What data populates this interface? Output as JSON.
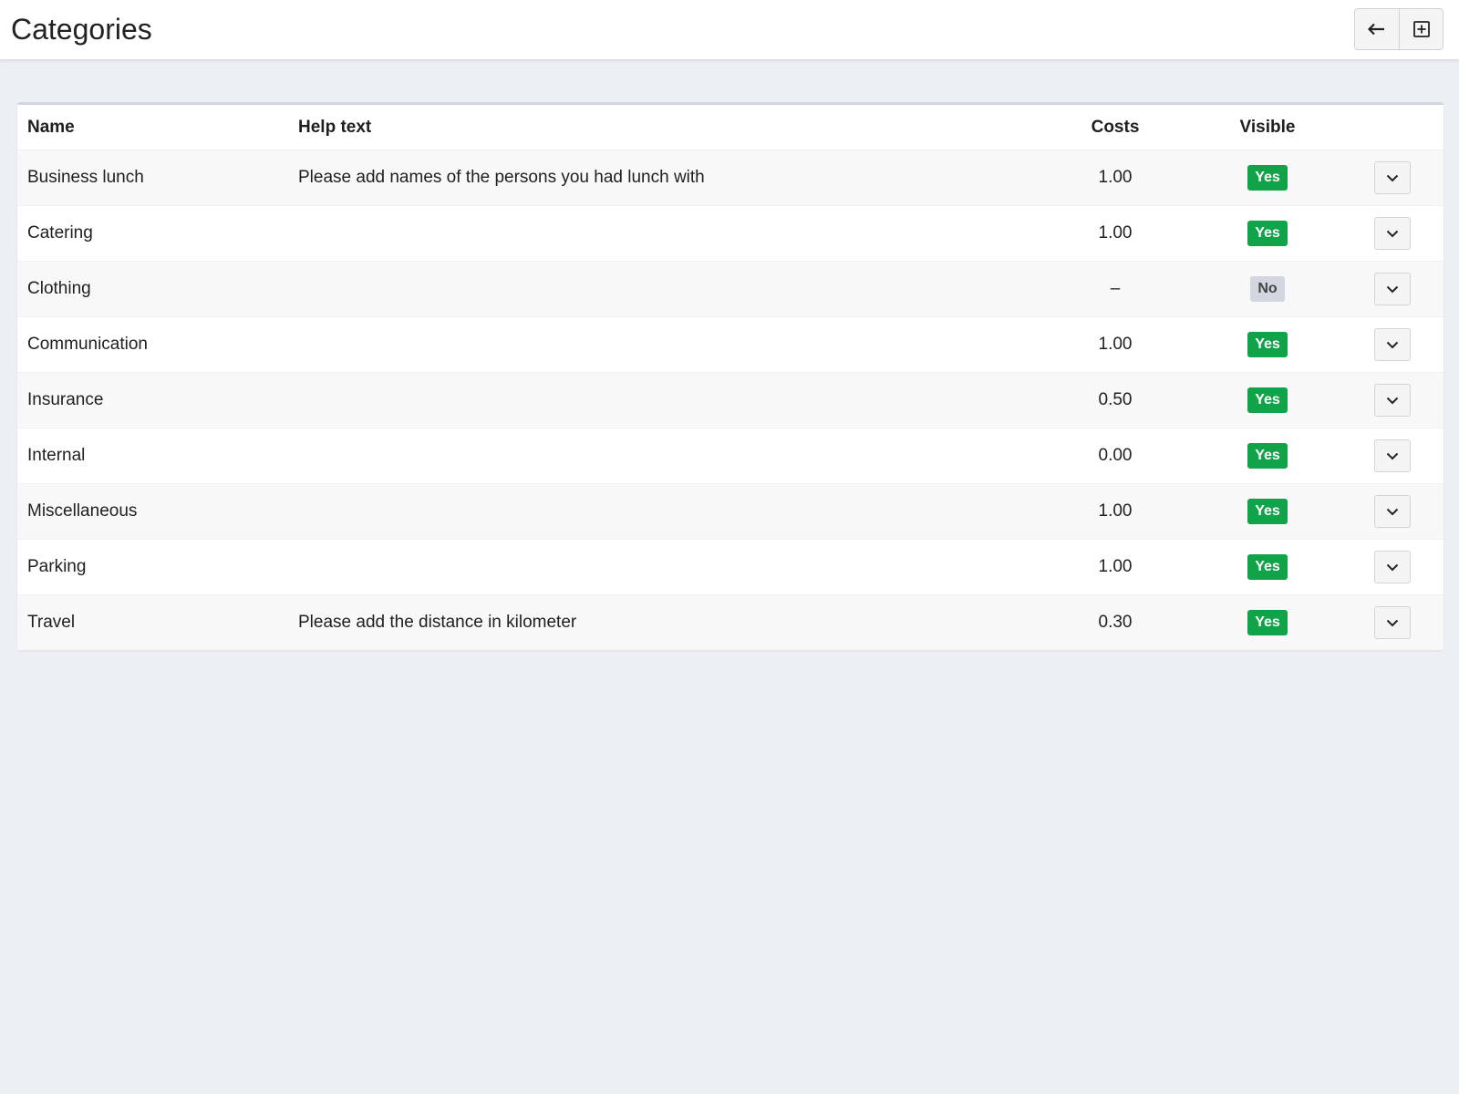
{
  "header": {
    "title": "Categories",
    "back_button_icon": "arrow-left-icon",
    "create_button_icon": "plus-square-icon"
  },
  "table": {
    "columns": {
      "name": "Name",
      "help": "Help text",
      "costs": "Costs",
      "visible": "Visible"
    },
    "rows": [
      {
        "name": "Business lunch",
        "help": "Please add names of the persons you had lunch with",
        "costs": "1.00",
        "visible": "Yes"
      },
      {
        "name": "Catering",
        "help": "",
        "costs": "1.00",
        "visible": "Yes"
      },
      {
        "name": "Clothing",
        "help": "",
        "costs": "–",
        "visible": "No"
      },
      {
        "name": "Communication",
        "help": "",
        "costs": "1.00",
        "visible": "Yes"
      },
      {
        "name": "Insurance",
        "help": "",
        "costs": "0.50",
        "visible": "Yes"
      },
      {
        "name": "Internal",
        "help": "",
        "costs": "0.00",
        "visible": "Yes"
      },
      {
        "name": "Miscellaneous",
        "help": "",
        "costs": "1.00",
        "visible": "Yes"
      },
      {
        "name": "Parking",
        "help": "",
        "costs": "1.00",
        "visible": "Yes"
      },
      {
        "name": "Travel",
        "help": "Please add the distance in kilometer",
        "costs": "0.30",
        "visible": "Yes"
      }
    ],
    "row_action_icon": "chevron-down-icon"
  },
  "colors": {
    "badge_yes": "#10a34a",
    "badge_no": "#d2d6de",
    "background": "#eceff3"
  }
}
